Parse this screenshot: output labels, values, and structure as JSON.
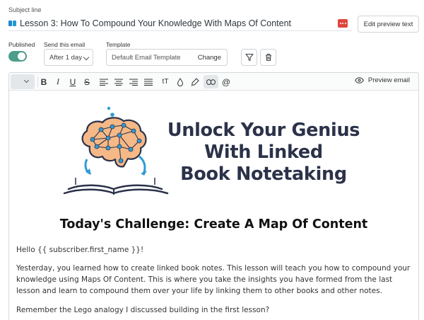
{
  "subject": {
    "label": "Subject line",
    "value": "Lesson 3: How To Compound Your Knowledge With Maps Of Content",
    "edit_preview_label": "Edit preview text"
  },
  "settings": {
    "published_label": "Published",
    "published": true,
    "send_label": "Send this email",
    "send_value": "After 1 day",
    "template_label": "Template",
    "template_value": "Default Email Template",
    "template_change": "Change"
  },
  "toolbar": {
    "preview_label": "Preview email",
    "tools": [
      "bold",
      "italic",
      "underline",
      "strikethrough",
      "align-left",
      "align-center",
      "align-right",
      "align-justify",
      "text-size",
      "color",
      "highlight",
      "link",
      "mention"
    ]
  },
  "content": {
    "hero_lines": [
      "Unlock Your Genius",
      "With Linked",
      "Book Notetaking"
    ],
    "challenge_heading": "Today's Challenge: Create A Map Of Content",
    "greeting": "Hello {{ subscriber.first_name }}!",
    "paragraph1": "Yesterday, you learned how to create linked book notes. This lesson will teach you how to compound your knowledge using Maps Of Content. This is where you take the insights you have formed from the last lesson and learn to compound them over your life by linking them to other books and other notes.",
    "paragraph2": "Remember the Lego analogy I discussed building in the first lesson?"
  },
  "colors": {
    "toggle_on": "#4c9d8a",
    "snippet_red": "#e0463d",
    "hero_navy": "#2b3249",
    "brain_fill": "#f5b887",
    "node_blue": "#2f9bd6"
  }
}
